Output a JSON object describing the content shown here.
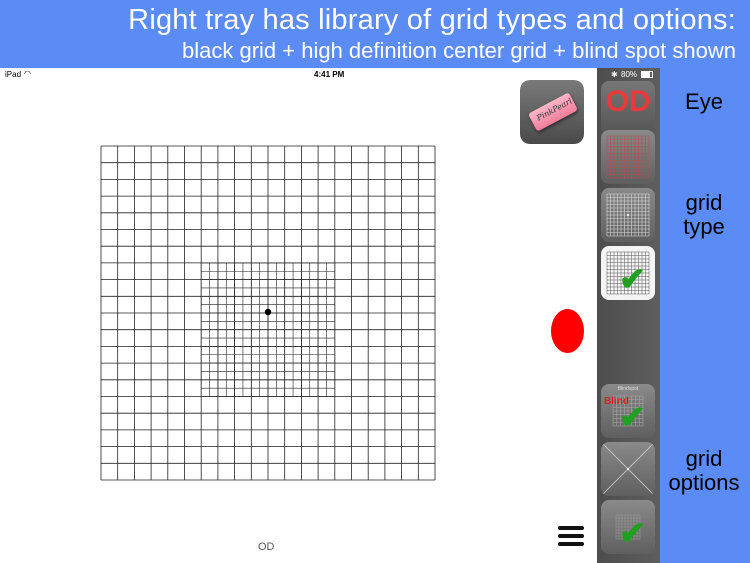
{
  "banner": {
    "title": "Right tray has library of grid types and options:",
    "subtitle": "black grid + high definition center grid  + blind spot shown"
  },
  "status_bar": {
    "carrier": "iPad",
    "time": "4:41 PM",
    "battery": "80%"
  },
  "screen": {
    "eye_label": "OD"
  },
  "tray": {
    "eye_button": "OD",
    "blind_option_header": "Blindspot",
    "blind_option_label": "Blind"
  },
  "annotations": {
    "eye": "Eye",
    "grid_type_line1": "grid",
    "grid_type_line2": "type",
    "grid_options_line1": "grid",
    "grid_options_line2": "options"
  },
  "icons": {
    "eraser": "eraser-icon",
    "menu": "hamburger-menu-icon",
    "check": "checkmark-icon"
  },
  "colors": {
    "banner_bg": "#5b8cf5",
    "blind_spot": "#ff0000",
    "check": "#1fa01f",
    "od_text": "#e83a3a"
  }
}
